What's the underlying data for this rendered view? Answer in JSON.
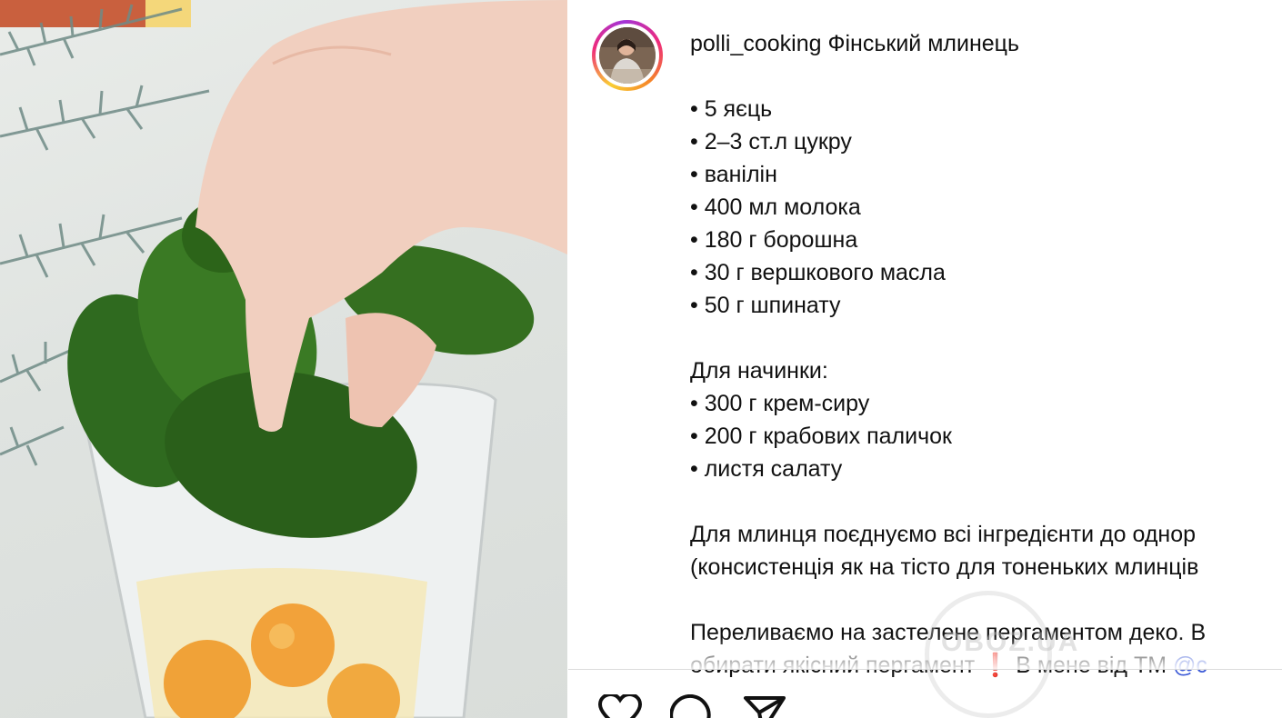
{
  "post": {
    "username": "polli_cooking",
    "title": "Фінський млинець",
    "ingredients": [
      "• 5 яєць",
      "• 2–3 ст.л цукру",
      "• ванілін",
      "• 400 мл молока",
      "• 180 г борошна",
      "• 30 г вершкового масла",
      "• 50 г шпинату"
    ],
    "filling_header": "Для начинки:",
    "filling": [
      "• 300 г крем-сиру",
      "• 200 г крабових паличок",
      "• листя салату"
    ],
    "paragraph1_line1": "Для млинця поєднуємо всі інгредієнти до однор",
    "paragraph1_line2": "(консистенція як на тісто для тоненьких млинців",
    "paragraph2_line1": "Переливаємо на застелене пергаментом деко. В",
    "paragraph2_line2_a": "обирати якісний пергамент ",
    "paragraph2_line2_mark": "❗",
    "paragraph2_line2_b": " В мене від ТМ ",
    "paragraph2_line2_mention": "@c"
  },
  "actions": {
    "like_icon": "heart-icon",
    "comment_icon": "comment-icon",
    "share_icon": "share-icon"
  },
  "watermark": "OBOZ.UA",
  "colors": {
    "link": "#3b59d6",
    "ring_start": "#f9ce34",
    "ring_mid": "#ee2a7b",
    "ring_end": "#a334d8"
  }
}
